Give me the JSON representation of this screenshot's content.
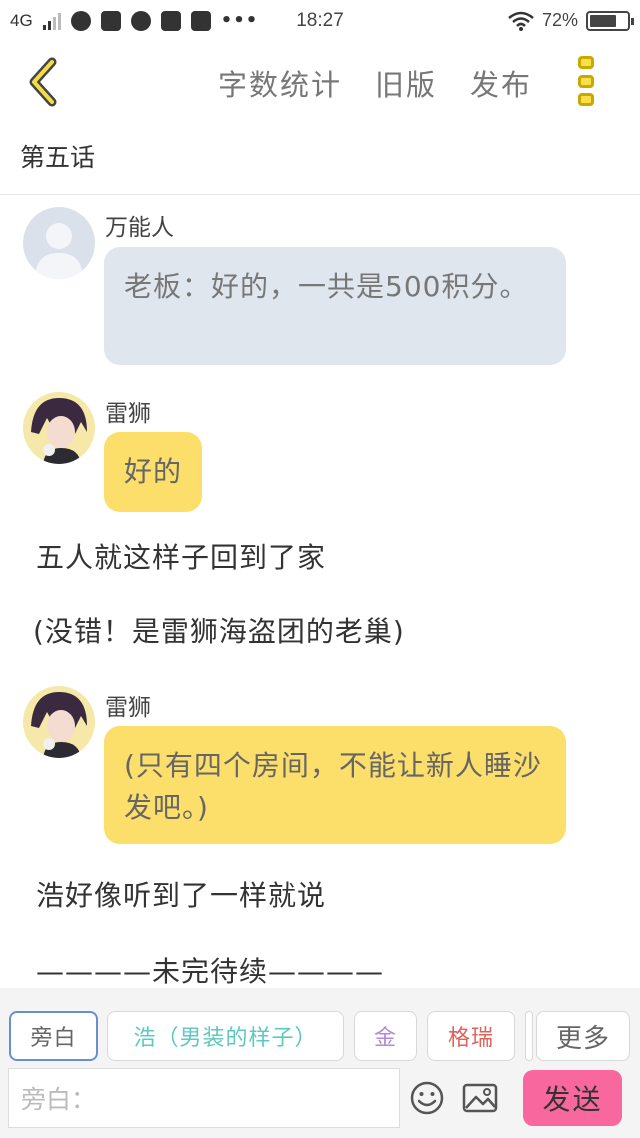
{
  "status_bar": {
    "network": "4G",
    "time": "18:27",
    "battery_pct": "72%",
    "battery_level": 0.72,
    "icons": [
      "signal-icon",
      "app-icon",
      "data-icon",
      "wechat-icon",
      "s-icon",
      "gallery-icon",
      "more-dots-icon",
      "wifi-icon",
      "battery-icon"
    ]
  },
  "toolbar": {
    "back_icon": "chevron-left-icon",
    "word_count": "字数统计",
    "old_version": "旧版",
    "publish": "发布",
    "more_icon": "vertical-menu-icon"
  },
  "chapter_title": "第五话",
  "messages": [
    {
      "type": "dialogue",
      "speaker": "万能人",
      "avatar": "default-avatar",
      "style": "grey",
      "text": "老板：好的，一共是500积分。"
    },
    {
      "type": "dialogue",
      "speaker": "雷狮",
      "avatar": "character-avatar",
      "style": "yellow",
      "text": "好的"
    },
    {
      "type": "narration",
      "text": "五人就这样子回到了家"
    },
    {
      "type": "narration",
      "text": "(没错！是雷狮海盗团的老巢)"
    },
    {
      "type": "dialogue",
      "speaker": "雷狮",
      "avatar": "character-avatar",
      "style": "yellow",
      "text": "(只有四个房间，不能让新人睡沙发吧。)"
    },
    {
      "type": "narration",
      "text": "浩好像听到了一样就说"
    },
    {
      "type": "narration",
      "text": "————未完待续————"
    }
  ],
  "role_chips": [
    {
      "label": "旁白",
      "color": "#888888",
      "selected": true
    },
    {
      "label": "浩（男装的样子）",
      "color": "#5ec8c0",
      "selected": false
    },
    {
      "label": "金",
      "color": "#b38ad6",
      "selected": false
    },
    {
      "label": "格瑞",
      "color": "#e0605a",
      "selected": false
    },
    {
      "label": "更多",
      "color": "#666666",
      "selected": false
    }
  ],
  "input": {
    "placeholder": "旁白："
  },
  "send_label": "发送",
  "colors": {
    "accent_yellow": "#fcde6a",
    "send_pink": "#f8689e",
    "grey_bubble": "#dfe6ed",
    "chip_selected_border": "#6a8fd0"
  }
}
